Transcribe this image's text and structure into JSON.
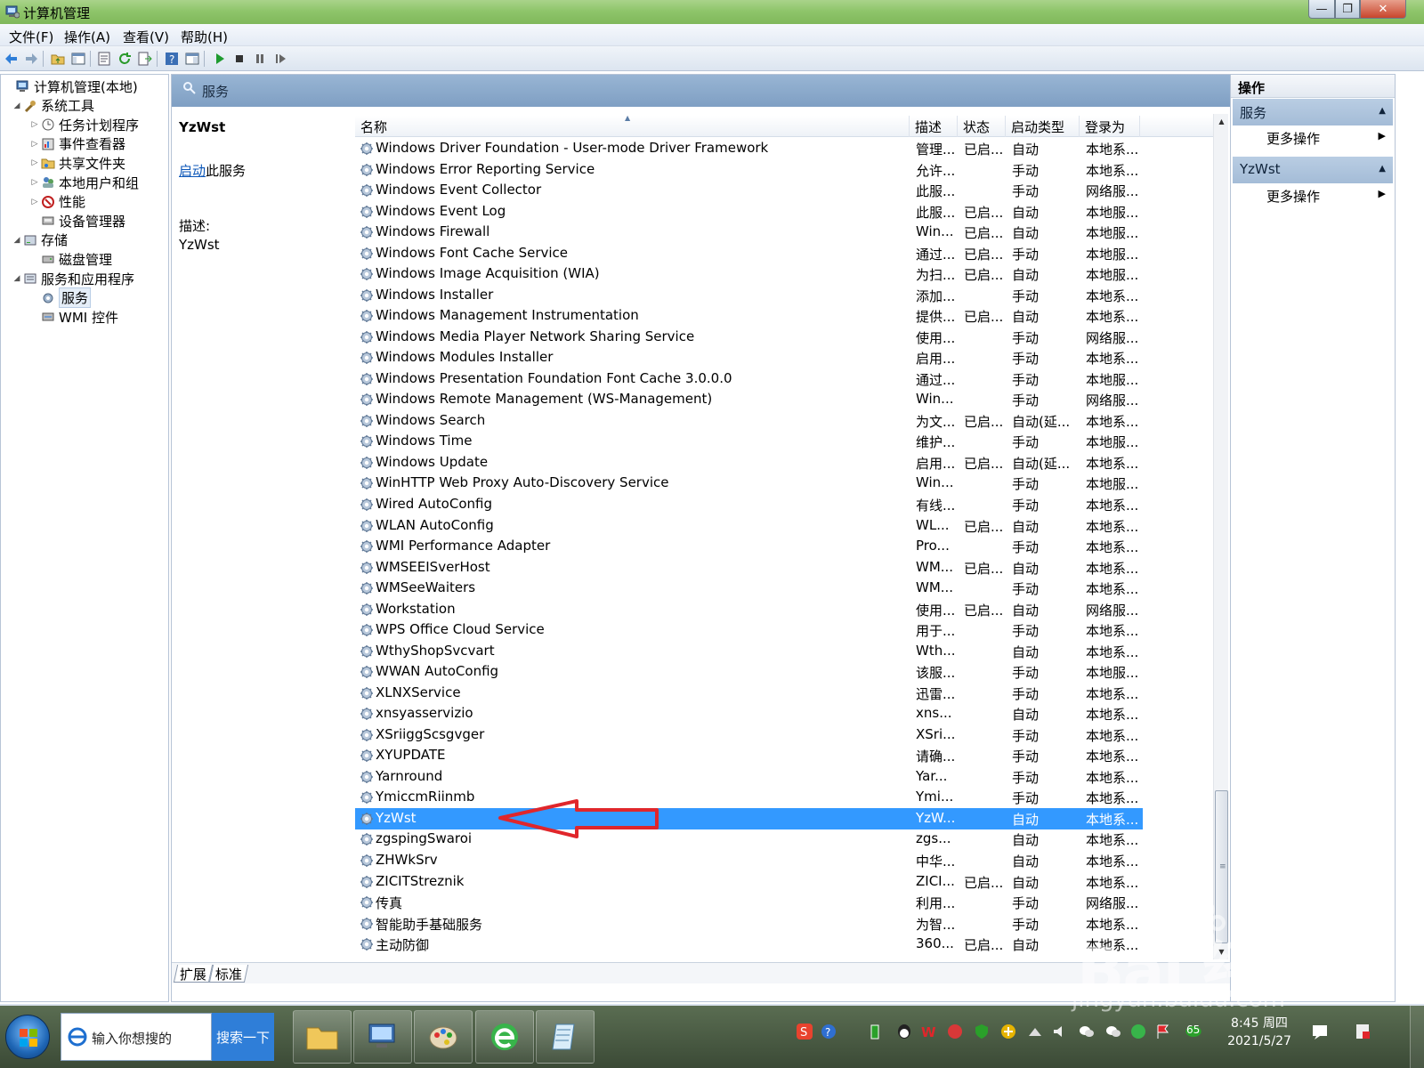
{
  "window": {
    "title": "计算机管理",
    "min_glyph": "—",
    "max_glyph": "❐",
    "close_glyph": "✕"
  },
  "menu": [
    "文件(F)",
    "操作(A)",
    "查看(V)",
    "帮助(H)"
  ],
  "tree": [
    {
      "label": "计算机管理(本地)",
      "arrow": "",
      "icon": "computer-management-icon"
    },
    {
      "label": "系统工具",
      "arrow": "◢",
      "icon": "tools-icon"
    },
    {
      "label": "任务计划程序",
      "arrow": "▷",
      "icon": "clock-icon"
    },
    {
      "label": "事件查看器",
      "arrow": "▷",
      "icon": "event-viewer-icon"
    },
    {
      "label": "共享文件夹",
      "arrow": "▷",
      "icon": "shared-folder-icon"
    },
    {
      "label": "本地用户和组",
      "arrow": "▷",
      "icon": "users-icon"
    },
    {
      "label": "性能",
      "arrow": "▷",
      "icon": "performance-icon"
    },
    {
      "label": "设备管理器",
      "arrow": "",
      "icon": "device-manager-icon"
    },
    {
      "label": "存储",
      "arrow": "◢",
      "icon": "storage-icon"
    },
    {
      "label": "磁盘管理",
      "arrow": "",
      "icon": "disk-icon"
    },
    {
      "label": "服务和应用程序",
      "arrow": "◢",
      "icon": "services-apps-icon"
    },
    {
      "label": "服务",
      "arrow": "",
      "icon": "gear-icon",
      "selected": true
    },
    {
      "label": "WMI 控件",
      "arrow": "",
      "icon": "wmi-icon"
    }
  ],
  "center": {
    "header_title": "服务",
    "selected_name": "YzWst",
    "start_link": "启动",
    "start_suffix": "此服务",
    "desc_label": "描述:",
    "desc_text": "YzWst"
  },
  "columns": {
    "name": "名称",
    "desc": "描述",
    "status": "状态",
    "start": "启动类型",
    "logon": "登录为"
  },
  "services": [
    {
      "name": "Windows Driver Foundation - User-mode Driver Framework",
      "desc": "管理...",
      "status": "已启...",
      "start": "自动",
      "logon": "本地系..."
    },
    {
      "name": "Windows Error Reporting Service",
      "desc": "允许...",
      "status": "",
      "start": "手动",
      "logon": "本地系..."
    },
    {
      "name": "Windows Event Collector",
      "desc": "此服...",
      "status": "",
      "start": "手动",
      "logon": "网络服..."
    },
    {
      "name": "Windows Event Log",
      "desc": "此服...",
      "status": "已启...",
      "start": "自动",
      "logon": "本地服..."
    },
    {
      "name": "Windows Firewall",
      "desc": "Win...",
      "status": "已启...",
      "start": "自动",
      "logon": "本地服..."
    },
    {
      "name": "Windows Font Cache Service",
      "desc": "通过...",
      "status": "已启...",
      "start": "手动",
      "logon": "本地服..."
    },
    {
      "name": "Windows Image Acquisition (WIA)",
      "desc": "为扫...",
      "status": "已启...",
      "start": "自动",
      "logon": "本地服..."
    },
    {
      "name": "Windows Installer",
      "desc": "添加...",
      "status": "",
      "start": "手动",
      "logon": "本地系..."
    },
    {
      "name": "Windows Management Instrumentation",
      "desc": "提供...",
      "status": "已启...",
      "start": "自动",
      "logon": "本地系..."
    },
    {
      "name": "Windows Media Player Network Sharing Service",
      "desc": "使用...",
      "status": "",
      "start": "手动",
      "logon": "网络服..."
    },
    {
      "name": "Windows Modules Installer",
      "desc": "启用...",
      "status": "",
      "start": "手动",
      "logon": "本地系..."
    },
    {
      "name": "Windows Presentation Foundation Font Cache 3.0.0.0",
      "desc": "通过...",
      "status": "",
      "start": "手动",
      "logon": "本地服..."
    },
    {
      "name": "Windows Remote Management (WS-Management)",
      "desc": "Win...",
      "status": "",
      "start": "手动",
      "logon": "网络服..."
    },
    {
      "name": "Windows Search",
      "desc": "为文...",
      "status": "已启...",
      "start": "自动(延...",
      "logon": "本地系..."
    },
    {
      "name": "Windows Time",
      "desc": "维护...",
      "status": "",
      "start": "手动",
      "logon": "本地服..."
    },
    {
      "name": "Windows Update",
      "desc": "启用...",
      "status": "已启...",
      "start": "自动(延...",
      "logon": "本地系..."
    },
    {
      "name": "WinHTTP Web Proxy Auto-Discovery Service",
      "desc": "Win...",
      "status": "",
      "start": "手动",
      "logon": "本地服..."
    },
    {
      "name": "Wired AutoConfig",
      "desc": "有线...",
      "status": "",
      "start": "手动",
      "logon": "本地系..."
    },
    {
      "name": "WLAN AutoConfig",
      "desc": "WL...",
      "status": "已启...",
      "start": "自动",
      "logon": "本地系..."
    },
    {
      "name": "WMI Performance Adapter",
      "desc": "Pro...",
      "status": "",
      "start": "手动",
      "logon": "本地系..."
    },
    {
      "name": "WMSEEISverHost",
      "desc": "WM...",
      "status": "已启...",
      "start": "自动",
      "logon": "本地系..."
    },
    {
      "name": "WMSeeWaiters",
      "desc": "WM...",
      "status": "",
      "start": "手动",
      "logon": "本地系..."
    },
    {
      "name": "Workstation",
      "desc": "使用...",
      "status": "已启...",
      "start": "自动",
      "logon": "网络服..."
    },
    {
      "name": "WPS Office Cloud Service",
      "desc": "用于...",
      "status": "",
      "start": "手动",
      "logon": "本地系..."
    },
    {
      "name": "WthyShopSvcvart",
      "desc": "Wth...",
      "status": "",
      "start": "自动",
      "logon": "本地系..."
    },
    {
      "name": "WWAN AutoConfig",
      "desc": "该服...",
      "status": "",
      "start": "手动",
      "logon": "本地服..."
    },
    {
      "name": "XLNXService",
      "desc": "迅雷...",
      "status": "",
      "start": "手动",
      "logon": "本地系..."
    },
    {
      "name": "xnsyasservizio",
      "desc": "xns...",
      "status": "",
      "start": "自动",
      "logon": "本地系..."
    },
    {
      "name": "XSriiggScsgvger",
      "desc": "XSri...",
      "status": "",
      "start": "手动",
      "logon": "本地系..."
    },
    {
      "name": "XYUPDATE",
      "desc": "请确...",
      "status": "",
      "start": "手动",
      "logon": "本地系..."
    },
    {
      "name": "Yarnround",
      "desc": "Yar...",
      "status": "",
      "start": "手动",
      "logon": "本地系..."
    },
    {
      "name": "YmiccmRiinmb",
      "desc": "Ymi...",
      "status": "",
      "start": "手动",
      "logon": "本地系..."
    },
    {
      "name": "YzWst",
      "desc": "YzW...",
      "status": "",
      "start": "自动",
      "logon": "本地系...",
      "selected": true
    },
    {
      "name": "zgspingSwaroi",
      "desc": "zgs...",
      "status": "",
      "start": "自动",
      "logon": "本地系..."
    },
    {
      "name": "ZHWkSrv",
      "desc": "中华...",
      "status": "",
      "start": "自动",
      "logon": "本地系..."
    },
    {
      "name": "ZICITStreznik",
      "desc": "ZICI...",
      "status": "已启...",
      "start": "自动",
      "logon": "本地系..."
    },
    {
      "name": "传真",
      "desc": "利用...",
      "status": "",
      "start": "手动",
      "logon": "网络服..."
    },
    {
      "name": "智能助手基础服务",
      "desc": "为智...",
      "status": "",
      "start": "手动",
      "logon": "本地系..."
    },
    {
      "name": "主动防御",
      "desc": "360...",
      "status": "已启...",
      "start": "自动",
      "logon": "本地系..."
    }
  ],
  "tabs": [
    "扩展",
    "标准"
  ],
  "actions": {
    "title": "操作",
    "sections": [
      {
        "label": "服务",
        "item": "更多操作"
      },
      {
        "label": "YzWst",
        "item": "更多操作"
      }
    ]
  },
  "taskbar": {
    "search_text": "输入你想搜的",
    "search_button": "搜索一下",
    "clock_time": "8:45 周四",
    "clock_date": "2021/5/27",
    "tray_badge": "65"
  },
  "watermark": {
    "logo": "Bai 经验",
    "url": "jingyan.baidu.com"
  },
  "colors": {
    "selected_row": "#3399ff",
    "title_green": "#8fc56b",
    "annotation_red": "#e0262b"
  }
}
